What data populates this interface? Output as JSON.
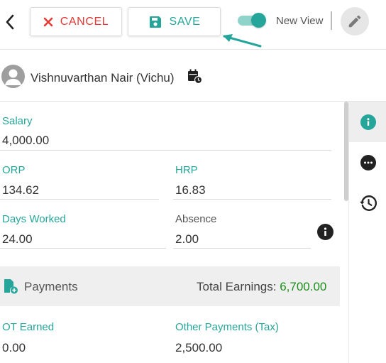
{
  "header": {
    "cancel_label": "CANCEL",
    "save_label": "SAVE",
    "new_view_label": "New View",
    "new_view_on": true
  },
  "employee": {
    "name": "Vishnuvarthan Nair (Vichu)"
  },
  "fields": {
    "salary": {
      "label": "Salary",
      "value": "4,000.00"
    },
    "orp": {
      "label": "ORP",
      "value": "134.62"
    },
    "hrp": {
      "label": "HRP",
      "value": "16.83"
    },
    "days_worked": {
      "label": "Days Worked",
      "value": "24.00"
    },
    "absence": {
      "label": "Absence",
      "value": "2.00"
    },
    "ot_earned": {
      "label": "OT Earned",
      "value": "0.00"
    },
    "other_payments": {
      "label": "Other Payments (Tax)",
      "value": "2,500.00"
    }
  },
  "payments": {
    "label": "Payments",
    "total_label": "Total Earnings: ",
    "total_value": "6,700.00"
  },
  "colors": {
    "accent": "#26a69a",
    "danger": "#e53935",
    "total": "#1b8f1b"
  },
  "icons": [
    "back-chevron-icon",
    "close-icon",
    "save-disk-icon",
    "pencil-icon",
    "person-icon",
    "calendar-clock-icon",
    "info-icon",
    "more-icon",
    "history-icon",
    "payments-doc-icon"
  ]
}
